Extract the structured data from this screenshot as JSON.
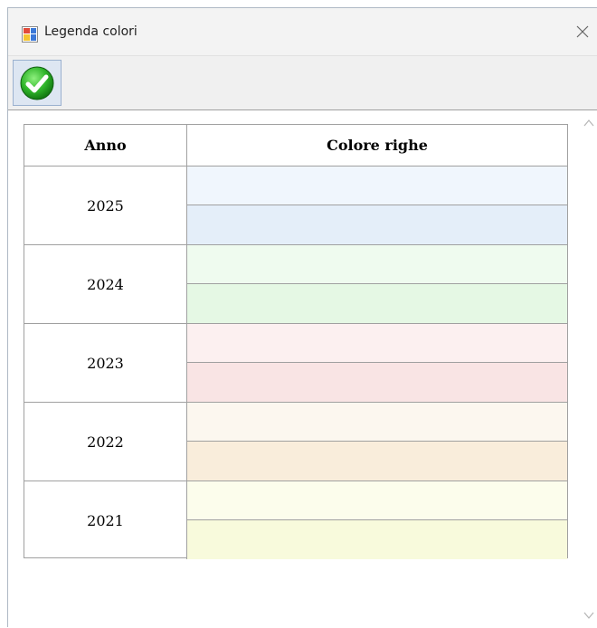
{
  "window": {
    "title": "Legenda colori",
    "title_icon": "app-window-icon",
    "close_icon": "close-icon"
  },
  "toolbar": {
    "ok_icon": "green-check-icon"
  },
  "table": {
    "headers": {
      "year": "Anno",
      "color": "Colore righe"
    },
    "rows": [
      {
        "year": "2025",
        "colors": [
          "#f0f6fd",
          "#e4eef9"
        ]
      },
      {
        "year": "2024",
        "colors": [
          "#effbef",
          "#e5f8e4"
        ]
      },
      {
        "year": "2023",
        "colors": [
          "#fcf0f0",
          "#f9e4e4"
        ]
      },
      {
        "year": "2022",
        "colors": [
          "#fcf7ef",
          "#f9eddb"
        ]
      },
      {
        "year": "2021",
        "colors": [
          "#fcfdec",
          "#f8fadc"
        ]
      }
    ]
  },
  "scrollbar": {
    "up_icon": "scroll-up-chevron-icon",
    "down_icon": "scroll-down-chevron-icon"
  }
}
